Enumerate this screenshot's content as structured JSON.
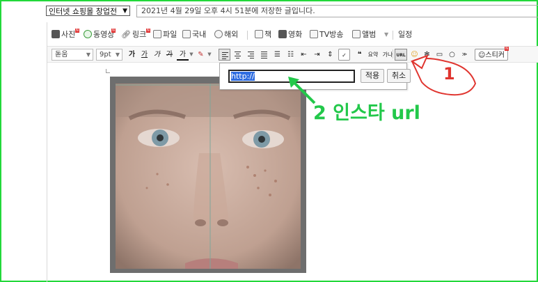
{
  "category_select": {
    "value": "인터넷 쇼핑몰 창업전"
  },
  "title_input": {
    "value": "2021년 4월 29일 오후 4시 51분에 저장한 글입니다."
  },
  "toolbar1": {
    "photo": "사진",
    "video": "동영상",
    "link": "링크",
    "file": "파일",
    "domestic": "국내",
    "overseas": "해외",
    "book": "책",
    "movie": "영화",
    "tv": "TV방송",
    "album": "앨범",
    "schedule": "일정"
  },
  "toolbar2": {
    "font": "돋움",
    "size": "9pt",
    "bold": "가",
    "underline": "가",
    "italic": "가",
    "strike": "가",
    "textcolor": "가",
    "spell": "맞춤",
    "quote": "\"",
    "summary": "요약",
    "quote2": "가나",
    "url": "URL",
    "sticker": "스티커"
  },
  "url_popup": {
    "value": "http://",
    "apply": "적용",
    "cancel": "취소"
  },
  "annotations": {
    "step1": "1",
    "step2": "2 인스타 url"
  },
  "colors": {
    "frame": "#22d83a",
    "annotation_red": "#e0352f",
    "annotation_green": "#22c84a",
    "selection": "#2f6de0"
  }
}
